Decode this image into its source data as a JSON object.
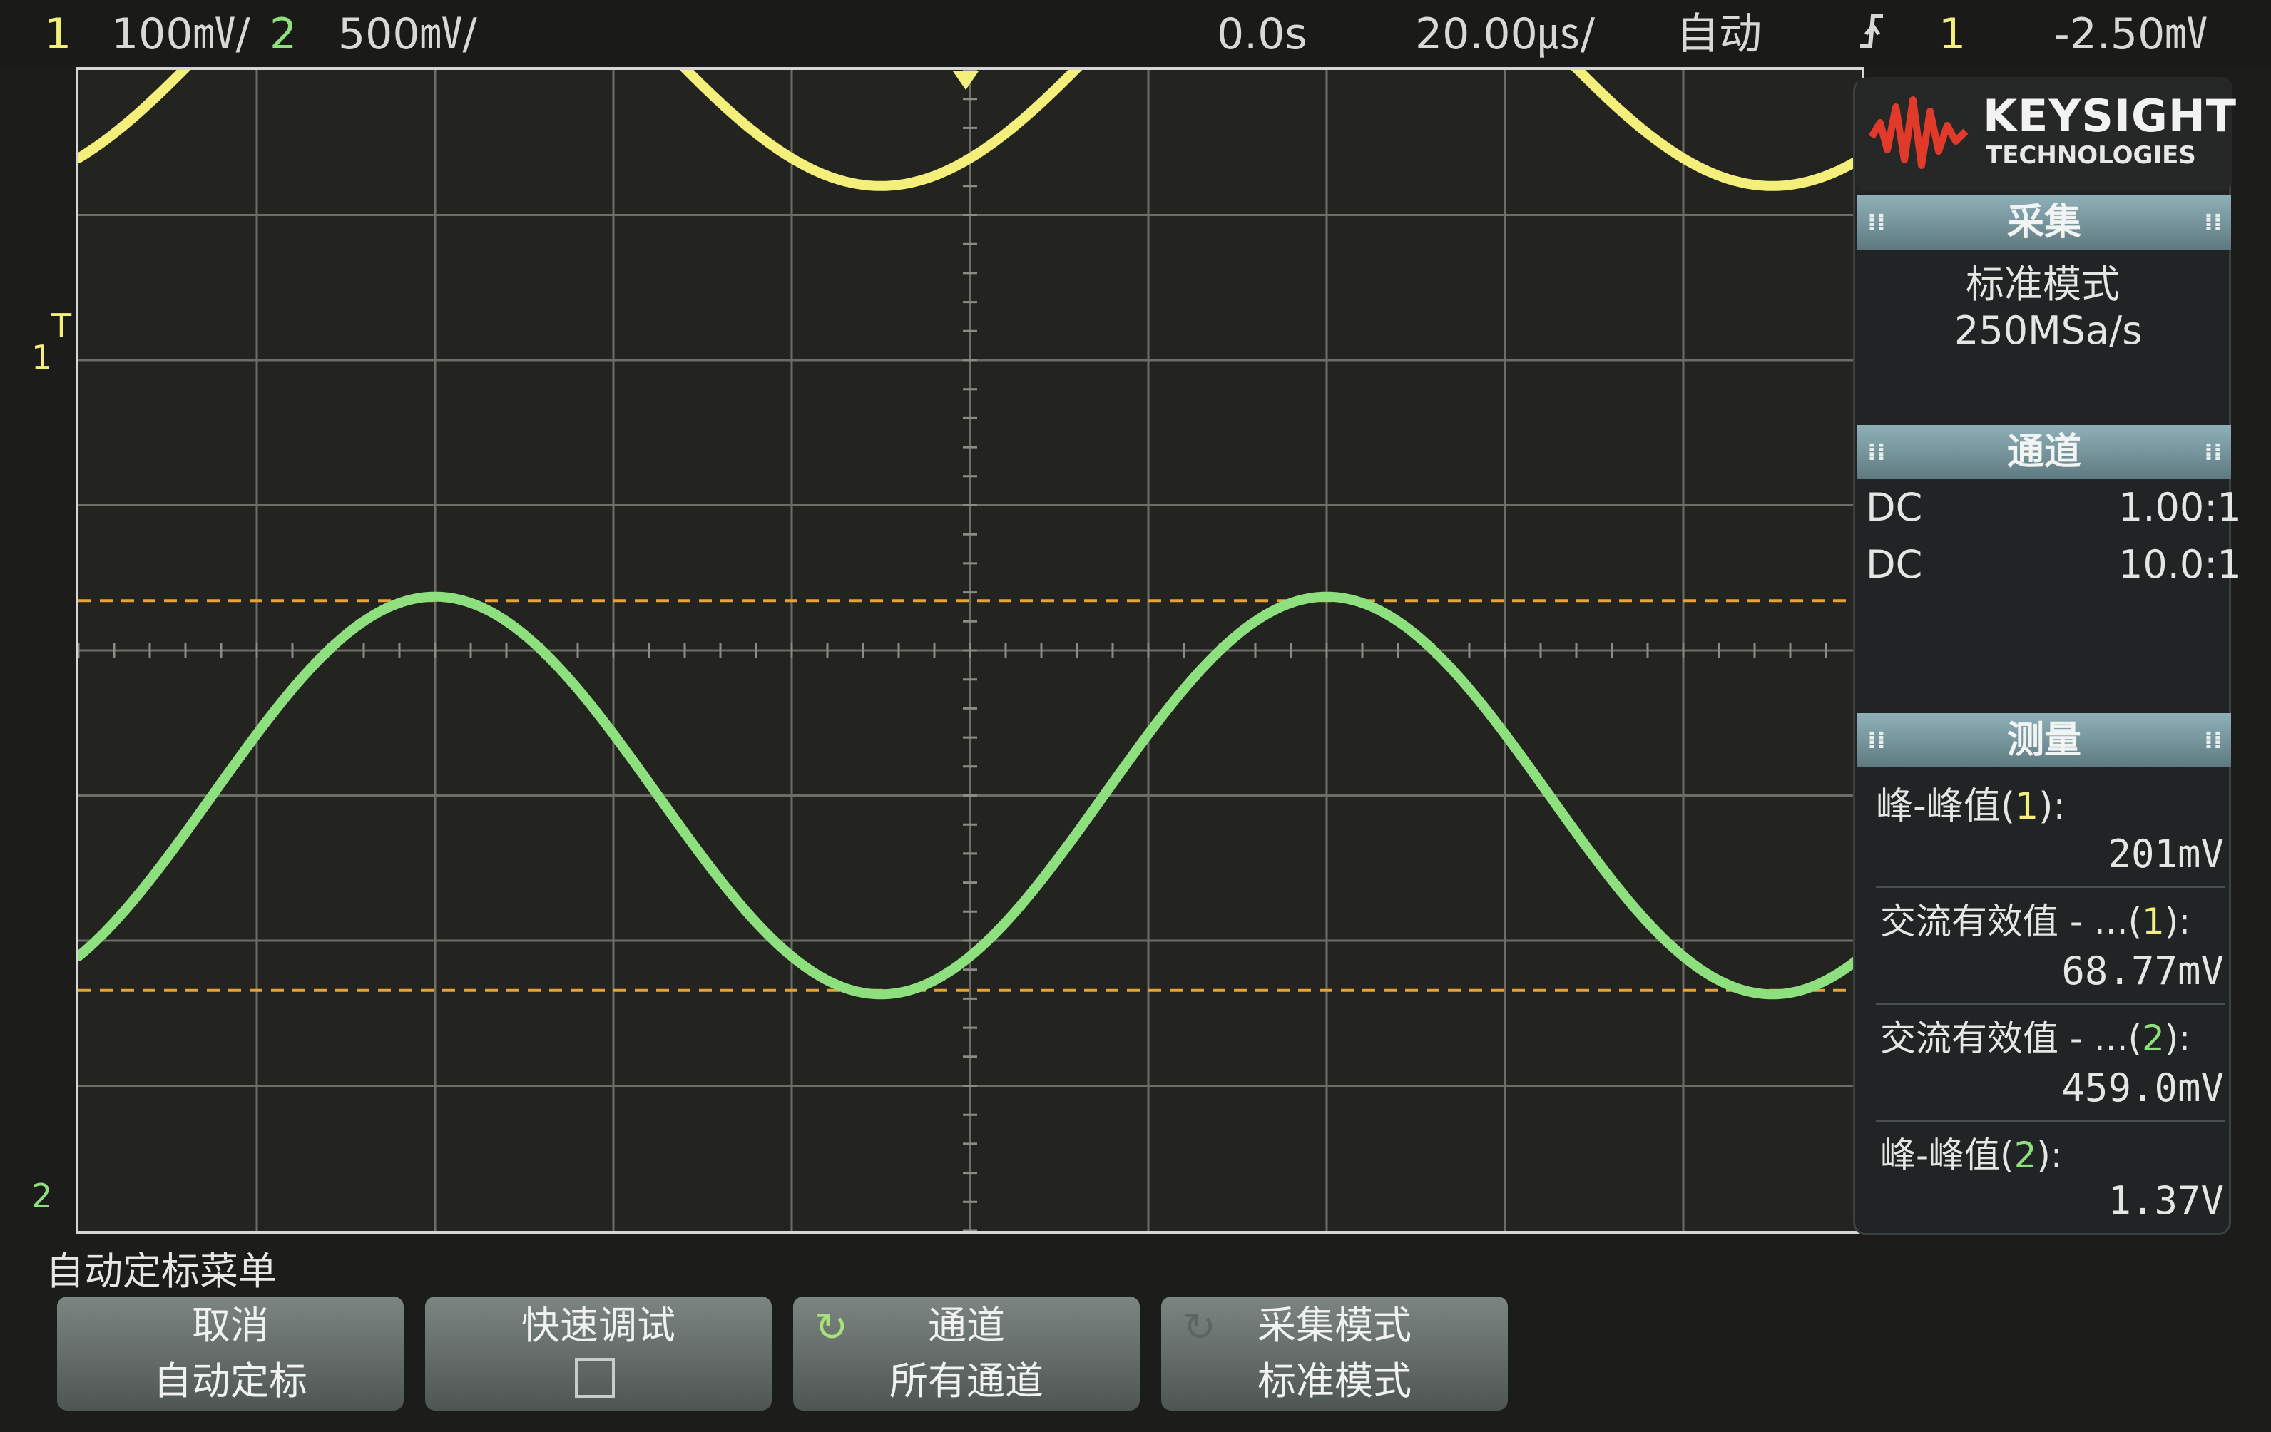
{
  "topbar": {
    "ch1_num": "1",
    "ch1_scale": "100㎷/",
    "ch2_num": "2",
    "ch2_scale": "500㎷/",
    "time_offset": "0.0s",
    "time_scale": "20.00㎲/",
    "trigger_mode": "自动",
    "trigger_icon": "edge-rising-icon",
    "trigger_source": "1",
    "trigger_level": "-2.50㎷"
  },
  "screen": {
    "ch1_marker": "1",
    "ch1_trigger_marker": "T",
    "ch2_marker": "2"
  },
  "chart_data": {
    "type": "line",
    "series": [
      {
        "name": "1",
        "color": "#f3ef7a",
        "amplitude_div": 1.0,
        "offset_div": 4.2
      },
      {
        "name": "2",
        "color": "#8ee07e",
        "amplitude_div": 1.37,
        "offset_div": -1.0
      }
    ],
    "x_div_range": [
      -5,
      5
    ],
    "y_div_range": [
      -4,
      4
    ],
    "grid": true
  },
  "brand": {
    "name": "KEYSIGHT",
    "sub": "TECHNOLOGIES"
  },
  "acquire": {
    "title": "采集",
    "mode": "标准模式",
    "rate": "250MSa/s"
  },
  "channels": {
    "title": "通道",
    "rows": [
      {
        "coupling": "DC",
        "probe": "1.00:1"
      },
      {
        "coupling": "DC",
        "probe": "10.0:1"
      }
    ]
  },
  "measure": {
    "title": "测量",
    "items": [
      {
        "label_pre": "峰-峰值(",
        "label_ch": "1",
        "label_post": "):",
        "value": "201mV"
      },
      {
        "label_pre": "交流有效值 - ...(",
        "label_ch": "1",
        "label_post": "):",
        "value": "68.77mV"
      },
      {
        "label_pre": "交流有效值 - ...(",
        "label_ch": "2",
        "label_post": "):",
        "value": "459.0mV"
      },
      {
        "label_pre": "峰-峰值(",
        "label_ch": "2",
        "label_post": "):",
        "value": "1.37V"
      }
    ]
  },
  "softkeys": {
    "menu_title": "自动定标菜单",
    "keys": [
      {
        "line1": "取消",
        "line2": "自动定标"
      },
      {
        "line1": "快速调试",
        "line2": ""
      },
      {
        "line1": "通道",
        "line2": "所有通道"
      },
      {
        "line1": "采集模式",
        "line2": "标准模式"
      }
    ]
  }
}
